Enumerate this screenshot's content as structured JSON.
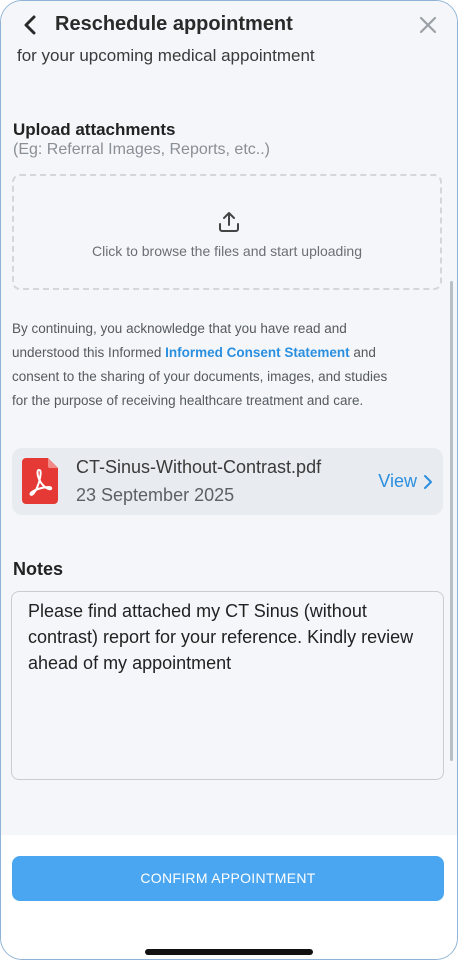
{
  "header": {
    "title": "Reschedule appointment",
    "back_icon": "chevron-left-icon",
    "close_icon": "close-icon"
  },
  "intro": {
    "subtitle": "for your upcoming medical appointment"
  },
  "upload": {
    "title": "Upload attachments",
    "hint": "(Eg: Referral Images, Reports, etc..)",
    "dropzone_text": "Click to browse the files and start uploading",
    "icon": "upload-icon"
  },
  "consent": {
    "prefix": "By continuing, you acknowledge that you have read and understood this Informed ",
    "link": "Informed Consent Statement",
    "suffix": " and consent to the sharing of your documents, images, and studies for the purpose of receiving healthcare treatment and care."
  },
  "attachment": {
    "file_name": "CT-Sinus-Without-Contrast.pdf",
    "date": "23 September 2025",
    "view_label": "View",
    "icon": "pdf-file-icon"
  },
  "notes": {
    "label": "Notes",
    "value": "Please find attached my CT Sinus (without contrast) report for your reference. Kindly review ahead of my appointment"
  },
  "footer": {
    "confirm_label": "CONFIRM APPOINTMENT"
  },
  "colors": {
    "accent": "#2b8fe0",
    "button": "#4aa6f0",
    "pdf_red": "#e53935",
    "background": "#f4f6f9"
  }
}
